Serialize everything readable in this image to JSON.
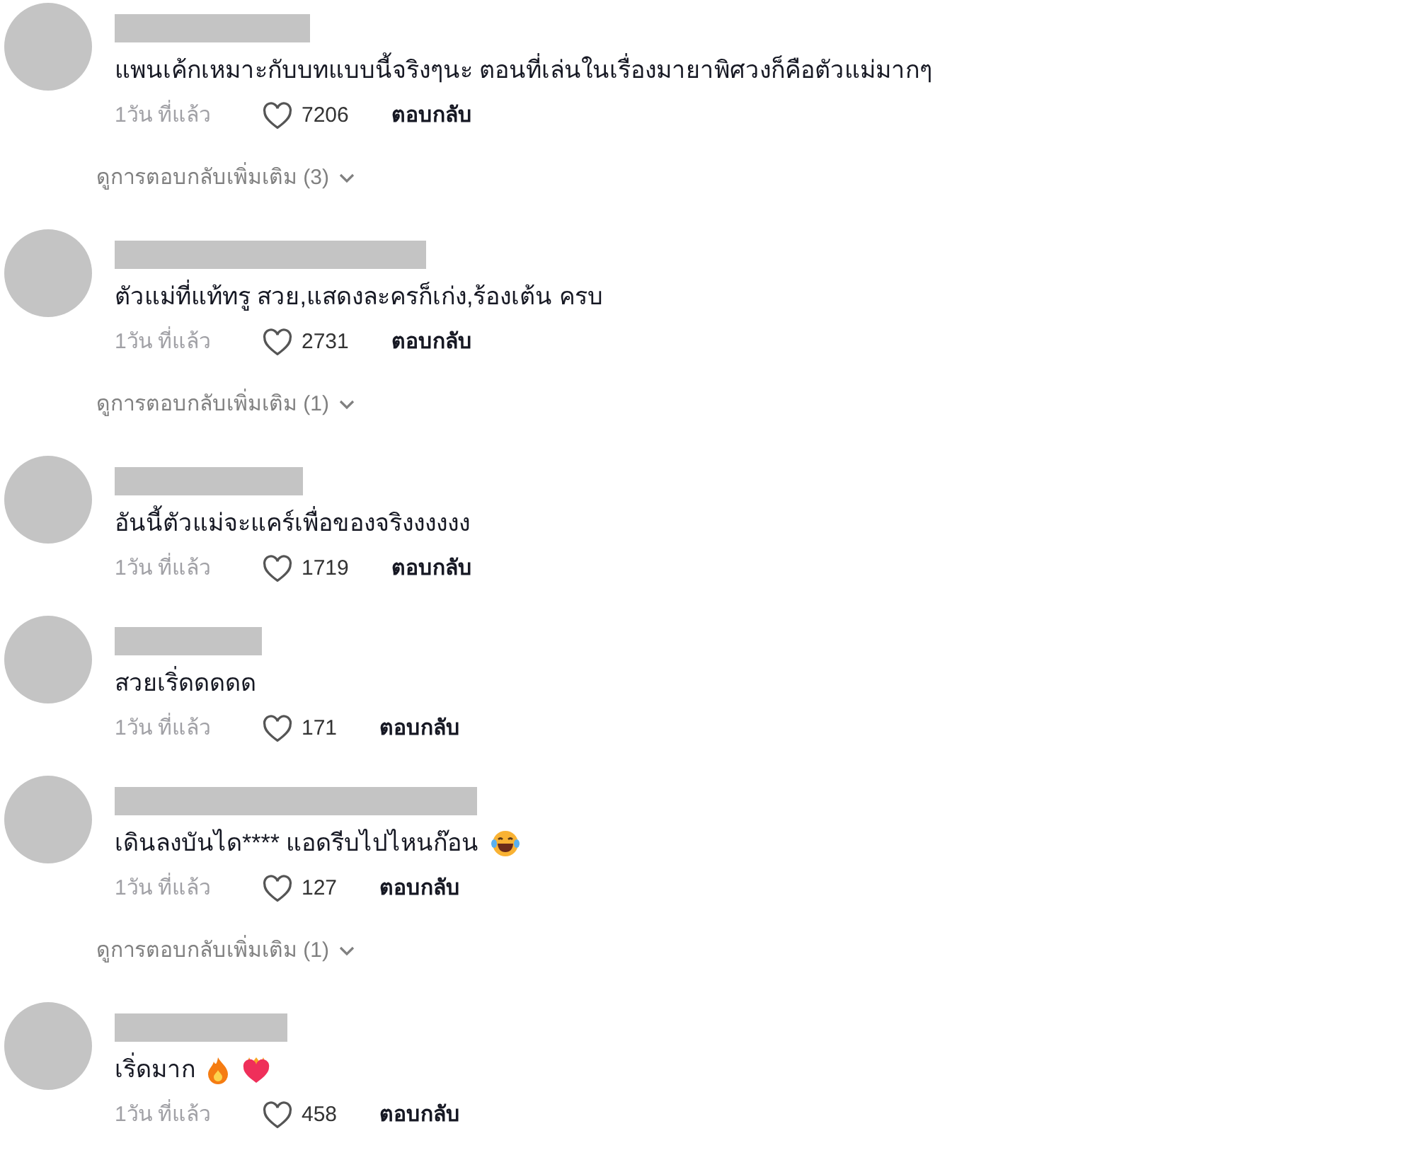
{
  "comments": [
    {
      "text": "แพนเค้กเหมาะกับบทแบบนี้จริงๆนะ ตอนที่เล่นในเรื่องมายาพิศวงก็คือตัวแม่มากๆ",
      "time": "1วัน ที่แล้ว",
      "likes": "7206",
      "reply": "ตอบกลับ",
      "more_replies": "ดูการตอบกลับเพิ่มเติม (3)"
    },
    {
      "text": "ตัวแม่ที่แท้ทรู สวย,แสดงละครก็เก่ง,ร้องเต้น ครบ",
      "time": "1วัน ที่แล้ว",
      "likes": "2731",
      "reply": "ตอบกลับ",
      "more_replies": "ดูการตอบกลับเพิ่มเติม (1)"
    },
    {
      "text": "อันนี้ตัวแม่จะแคร์เพื่อของจริงงงงงง",
      "time": "1วัน ที่แล้ว",
      "likes": "1719",
      "reply": "ตอบกลับ"
    },
    {
      "text": "สวยเริ่ดดดดด",
      "time": "1วัน ที่แล้ว",
      "likes": "171",
      "reply": "ตอบกลับ"
    },
    {
      "text": "เดินลงบันได**** แอดรีบไปไหนก๊อน",
      "emojis": [
        {
          "kind": "laughing"
        }
      ],
      "time": "1วัน ที่แล้ว",
      "likes": "127",
      "reply": "ตอบกลับ",
      "more_replies": "ดูการตอบกลับเพิ่มเติม (1)"
    },
    {
      "text": "เริ่ดมาก",
      "emojis": [
        {
          "kind": "fire"
        },
        {
          "kind": "heart-on-fire"
        }
      ],
      "time": "1วัน ที่แล้ว",
      "likes": "458",
      "reply": "ตอบกลับ"
    }
  ]
}
